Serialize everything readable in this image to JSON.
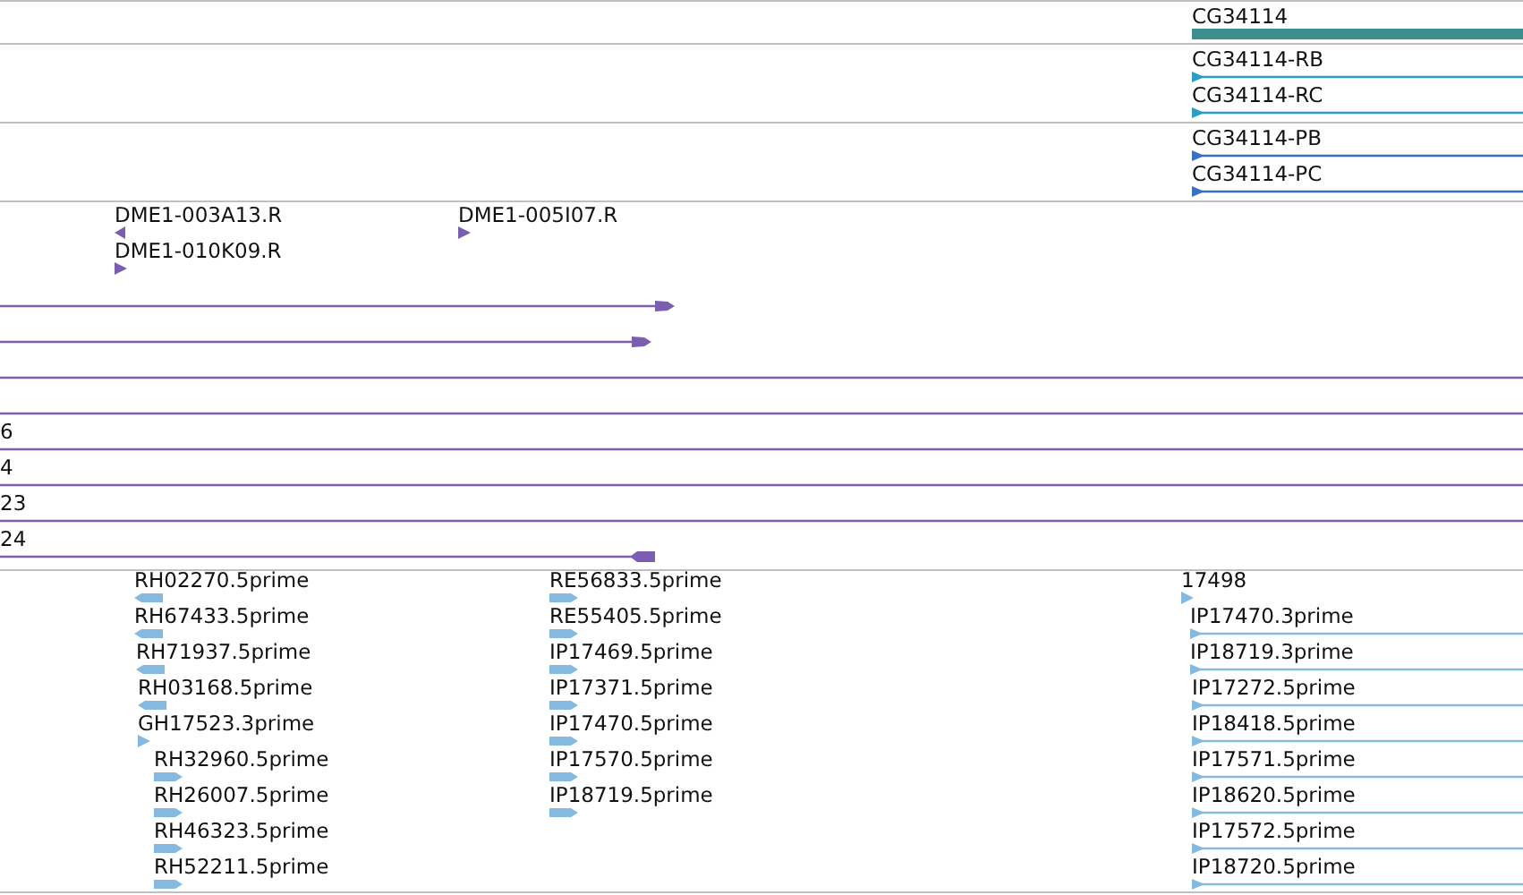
{
  "tracks": [
    {
      "color": "#3d8f8f",
      "features": [
        {
          "label": "CG34114",
          "kind": "bar"
        }
      ]
    },
    {
      "color": "#2a9fc2",
      "features": [
        {
          "label": "CG34114-RB",
          "kind": "line",
          "reverse": false
        },
        {
          "label": "CG34114-RC",
          "kind": "line",
          "reverse": false
        }
      ]
    },
    {
      "color": "#3a6fc8",
      "features": [
        {
          "label": "CG34114-PB",
          "kind": "line",
          "reverse": false
        },
        {
          "label": "CG34114-PC",
          "kind": "line",
          "reverse": false
        }
      ]
    },
    {
      "color": "#7a5fb0",
      "features": [
        {
          "label": "DME1-003A13.R",
          "kind": "tick",
          "reverse": true
        },
        {
          "label": "DME1-005I07.R",
          "kind": "tick",
          "reverse": false
        },
        {
          "label": "DME1-010K09.R",
          "kind": "tick",
          "reverse": false
        },
        {
          "kind": "span",
          "reverse": false
        },
        {
          "kind": "span",
          "reverse": false
        },
        {
          "kind": "rule"
        },
        {
          "kind": "rule"
        },
        {
          "label": "6",
          "kind": "rule"
        },
        {
          "label": "4",
          "kind": "rule"
        },
        {
          "label": "23",
          "kind": "rule"
        },
        {
          "label": "24",
          "kind": "span",
          "reverse": true
        }
      ]
    },
    {
      "color": "#86b9e0",
      "features": [
        {
          "label": "RH02270.5prime",
          "kind": "block",
          "reverse": true
        },
        {
          "label": "RE56833.5prime",
          "kind": "block",
          "reverse": false
        },
        {
          "label": "17498",
          "kind": "tick",
          "reverse": false
        },
        {
          "label": "RH67433.5prime",
          "kind": "block",
          "reverse": true
        },
        {
          "label": "RE55405.5prime",
          "kind": "block",
          "reverse": false
        },
        {
          "label": "IP17470.3prime",
          "kind": "line",
          "reverse": false
        },
        {
          "label": "RH71937.5prime",
          "kind": "block",
          "reverse": true
        },
        {
          "label": "IP17469.5prime",
          "kind": "block",
          "reverse": false
        },
        {
          "label": "IP18719.3prime",
          "kind": "line",
          "reverse": false
        },
        {
          "label": "RH03168.5prime",
          "kind": "block",
          "reverse": true
        },
        {
          "label": "IP17371.5prime",
          "kind": "block",
          "reverse": false
        },
        {
          "label": "IP17272.5prime",
          "kind": "line",
          "reverse": false
        },
        {
          "label": "GH17523.3prime",
          "kind": "tick",
          "reverse": false
        },
        {
          "label": "IP17470.5prime",
          "kind": "block",
          "reverse": false
        },
        {
          "label": "IP18418.5prime",
          "kind": "line",
          "reverse": false
        },
        {
          "label": "RH32960.5prime",
          "kind": "block",
          "reverse": false
        },
        {
          "label": "IP17570.5prime",
          "kind": "block",
          "reverse": false
        },
        {
          "label": "IP17571.5prime",
          "kind": "line",
          "reverse": false
        },
        {
          "label": "RH26007.5prime",
          "kind": "block",
          "reverse": false
        },
        {
          "label": "IP18719.5prime",
          "kind": "block",
          "reverse": false
        },
        {
          "label": "IP18620.5prime",
          "kind": "line",
          "reverse": false
        },
        {
          "label": "RH46323.5prime",
          "kind": "block",
          "reverse": false
        },
        {
          "label": "IP17572.5prime",
          "kind": "line",
          "reverse": false
        },
        {
          "label": "RH52211.5prime",
          "kind": "block",
          "reverse": false
        },
        {
          "label": "IP18720.5prime",
          "kind": "line",
          "reverse": false
        }
      ]
    }
  ]
}
